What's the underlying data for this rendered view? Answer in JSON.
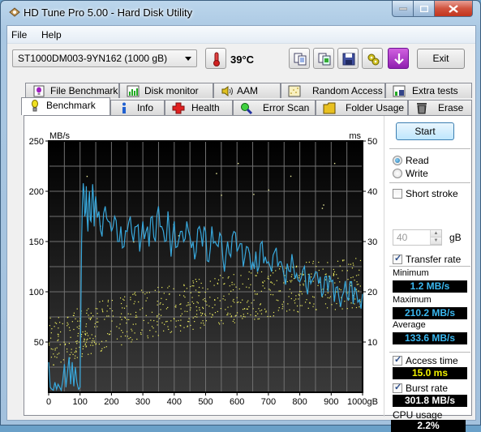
{
  "window": {
    "title": "HD Tune Pro 5.00 - Hard Disk Utility",
    "controls": [
      "minimize",
      "maximize",
      "close"
    ]
  },
  "menu": [
    {
      "label": "File",
      "accel": "F"
    },
    {
      "label": "Help",
      "accel": "H"
    }
  ],
  "toolbar": {
    "drive": "ST1000DM003-9YN162 (1000 gB)",
    "temperature": "39°C",
    "buttons": [
      "copy-text-icon",
      "copy-screenshot-icon",
      "save-icon",
      "options-icon",
      "download-icon"
    ],
    "exit_label": "Exit"
  },
  "tabs": {
    "row1": [
      {
        "label": "File Benchmark",
        "icon": "file-benchmark-icon"
      },
      {
        "label": "Disk monitor",
        "icon": "disk-monitor-icon"
      },
      {
        "label": "AAM",
        "icon": "speaker-icon"
      },
      {
        "label": "Random Access",
        "icon": "random-access-icon"
      },
      {
        "label": "Extra tests",
        "icon": "extra-tests-icon"
      }
    ],
    "row2": [
      {
        "label": "Benchmark",
        "icon": "lightbulb-icon",
        "active": true
      },
      {
        "label": "Info",
        "icon": "info-icon"
      },
      {
        "label": "Health",
        "icon": "health-cross-icon"
      },
      {
        "label": "Error Scan",
        "icon": "magnifier-icon"
      },
      {
        "label": "Folder Usage",
        "icon": "folder-icon"
      },
      {
        "label": "Erase",
        "icon": "trash-icon"
      }
    ]
  },
  "sidebar": {
    "start_label": "Start",
    "mode": {
      "options": [
        "Read",
        "Write"
      ],
      "selected": "Read"
    },
    "short_stroke": {
      "label": "Short stroke",
      "checked": false,
      "value": "40",
      "unit": "gB"
    },
    "transfer_rate": {
      "label": "Transfer rate",
      "checked": true
    },
    "minimum": {
      "label": "Minimum",
      "value": "1.2 MB/s"
    },
    "maximum": {
      "label": "Maximum",
      "value": "210.2 MB/s"
    },
    "average": {
      "label": "Average",
      "value": "133.6 MB/s"
    },
    "access_time": {
      "label": "Access time",
      "checked": true,
      "value": "15.0 ms"
    },
    "burst_rate": {
      "label": "Burst rate",
      "checked": true,
      "value": "301.8 MB/s"
    },
    "cpu_usage": {
      "label": "CPU usage",
      "value": "2.2%"
    }
  },
  "colors": {
    "transfer_line": "#38a8dc",
    "access_dots": "#f0f060",
    "min_max_avg_text": "#3ab8f0",
    "access_text": "#f0f000",
    "burst_cpu_text": "#ffffff"
  },
  "chart_data": {
    "type": "line",
    "title": "",
    "xlabel": "gB",
    "ylabel": "MB/s",
    "y2label": "ms",
    "xlim": [
      0,
      1000
    ],
    "ylim": [
      0,
      250
    ],
    "y2lim": [
      0,
      50
    ],
    "x_ticks": [
      "0",
      "100",
      "200",
      "300",
      "400",
      "500",
      "600",
      "700",
      "800",
      "900",
      "1000gB"
    ],
    "y_ticks": [
      "50",
      "100",
      "150",
      "200",
      "250"
    ],
    "y2_ticks": [
      "10",
      "20",
      "30",
      "40",
      "50"
    ],
    "grid": true,
    "series": [
      {
        "name": "Transfer rate",
        "axis": "left",
        "x": [
          0,
          5,
          10,
          15,
          20,
          25,
          30,
          35,
          40,
          45,
          50,
          55,
          60,
          65,
          70,
          75,
          80,
          85,
          90,
          95,
          100,
          105,
          110,
          115,
          120,
          125,
          130,
          135,
          140,
          145,
          150,
          160,
          170,
          180,
          190,
          200,
          210,
          220,
          230,
          240,
          250,
          260,
          270,
          280,
          290,
          300,
          310,
          320,
          330,
          340,
          350,
          360,
          370,
          380,
          390,
          400,
          410,
          420,
          430,
          440,
          450,
          460,
          470,
          480,
          490,
          500,
          510,
          520,
          530,
          540,
          550,
          560,
          570,
          580,
          590,
          600,
          610,
          620,
          630,
          640,
          650,
          660,
          670,
          680,
          690,
          700,
          710,
          720,
          730,
          740,
          750,
          760,
          770,
          780,
          790,
          800,
          810,
          820,
          830,
          840,
          850,
          860,
          870,
          880,
          890,
          900,
          910,
          920,
          930,
          940,
          950,
          960,
          970,
          980,
          990,
          1000
        ],
        "values": [
          30,
          5,
          3,
          2,
          10,
          3,
          8,
          5,
          2,
          12,
          28,
          5,
          20,
          35,
          8,
          30,
          6,
          25,
          10,
          3,
          5,
          150,
          208,
          175,
          205,
          160,
          200,
          170,
          207,
          165,
          195,
          180,
          155,
          185,
          170,
          160,
          175,
          150,
          165,
          145,
          160,
          175,
          150,
          165,
          140,
          170,
          160,
          145,
          175,
          150,
          185,
          165,
          150,
          180,
          135,
          170,
          145,
          160,
          150,
          170,
          155,
          150,
          140,
          165,
          145,
          160,
          130,
          165,
          150,
          145,
          155,
          120,
          150,
          135,
          160,
          140,
          148,
          125,
          145,
          138,
          130,
          140,
          125,
          150,
          135,
          130,
          120,
          140,
          125,
          130,
          115,
          128,
          120,
          125,
          118,
          110,
          122,
          105,
          118,
          112,
          120,
          108,
          95,
          115,
          100,
          110,
          90,
          105,
          85,
          100,
          95,
          110,
          88,
          100,
          92,
          98
        ]
      },
      {
        "name": "Access time",
        "axis": "right",
        "type": "scatter",
        "description": "seek time samples spread roughly 5–25 ms, increasing with position",
        "trend": [
          [
            0,
            10
          ],
          [
            200,
            14
          ],
          [
            400,
            17
          ],
          [
            600,
            19
          ],
          [
            800,
            21
          ],
          [
            1000,
            22
          ]
        ],
        "spread_ms": 5
      }
    ]
  }
}
